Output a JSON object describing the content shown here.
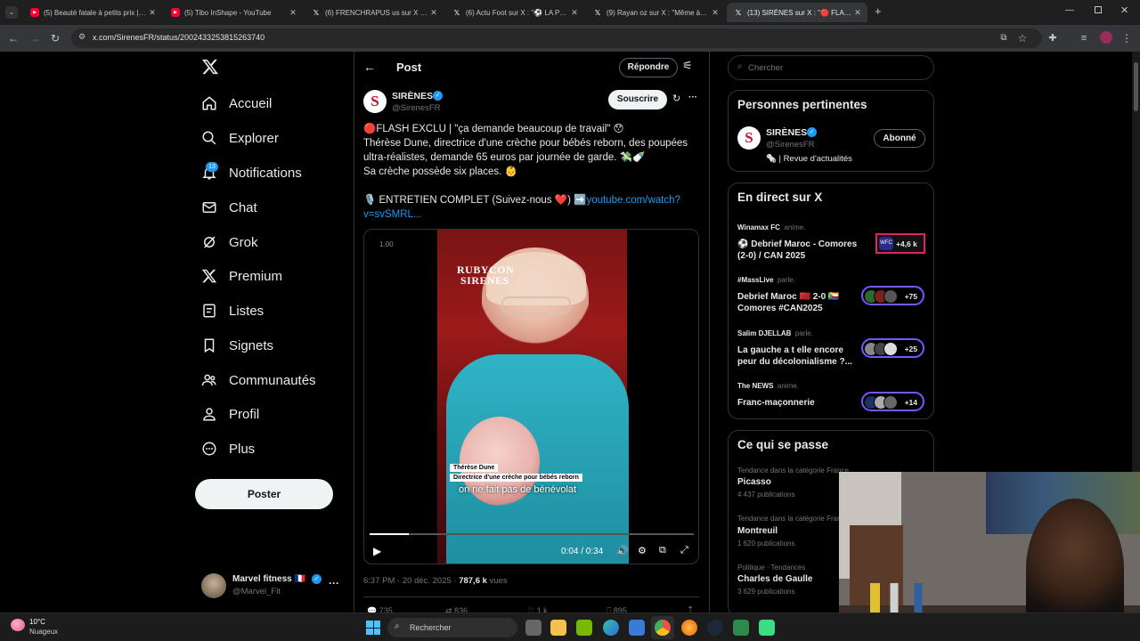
{
  "browser": {
    "tabs": [
      {
        "title": "(5) Beauté fatale à petits prix | ...",
        "icon": "youtube-icon"
      },
      {
        "title": "(5) Tibo InShape - YouTube",
        "icon": "youtube-icon"
      },
      {
        "title": "(6) FRENCHRAPUS us sur X : \"...",
        "icon": "x-icon"
      },
      {
        "title": "(6) Actu Foot sur X : \"⚽ LA PL...",
        "icon": "x-icon"
      },
      {
        "title": "(9) Rayan oz sur X : \"Même à la...",
        "icon": "x-icon"
      },
      {
        "title": "(13) SIRÈNES sur X : \"🔴 FLASH...",
        "icon": "x-icon",
        "active": true
      }
    ],
    "url": "x.com/SirenesFR/status/2002433253815263740"
  },
  "nav": {
    "items": [
      {
        "label": "Accueil",
        "icon": "home-icon"
      },
      {
        "label": "Explorer",
        "icon": "search-icon"
      },
      {
        "label": "Notifications",
        "icon": "bell-icon",
        "badge": "13"
      },
      {
        "label": "Chat",
        "icon": "mail-icon"
      },
      {
        "label": "Grok",
        "icon": "grok-icon"
      },
      {
        "label": "Premium",
        "icon": "x-logo-icon"
      },
      {
        "label": "Listes",
        "icon": "list-icon"
      },
      {
        "label": "Signets",
        "icon": "bookmark-icon"
      },
      {
        "label": "Communautés",
        "icon": "communities-icon"
      },
      {
        "label": "Profil",
        "icon": "person-icon"
      },
      {
        "label": "Plus",
        "icon": "more-circle-icon"
      }
    ],
    "post_button": "Poster",
    "account": {
      "name": "Marvel fitness 🇫🇷",
      "handle": "@Marvel_Flt"
    }
  },
  "post": {
    "header_title": "Post",
    "reply_button": "Répondre",
    "author_name": "SIRÈNES",
    "author_handle": "@SirenesFR",
    "subscribe_button": "Souscrire",
    "text_lines": [
      "🔴FLASH EXCLU | \"ça demande beaucoup de travail\" 😯",
      "Thérèse Dune, directrice d'une crèche pour bébés reborn, des poupées",
      "ultra-réalistes, demande 65 euros par journée de garde. 💸🍼",
      "Sa crèche possède six places. 👶",
      "🎙️ ENTRETIEN COMPLET (Suivez-nous ❤️) ➡️"
    ],
    "link_text_1": "youtube.com/watch?",
    "link_text_2": "v=svSMRL...",
    "video": {
      "speed_label": "1.00",
      "watermark_top": "RUBYCON",
      "watermark_bottom": "SIRENES",
      "caption_name": "Thérèse Dune",
      "caption_role": "Directrice d'une crèche pour bébés reborn",
      "subtitle": "on ne fait pas de bénévolat",
      "time": "0:04 / 0:34",
      "progress_fraction": 0.12
    },
    "meta_time": "6:37 PM · 20 déc. 2025 · ",
    "meta_views": "787,6 k",
    "meta_views_label": " vues",
    "actions": [
      "735",
      "836",
      "1 k",
      "895"
    ]
  },
  "search": {
    "placeholder": "Chercher"
  },
  "relevant": {
    "title": "Personnes pertinentes",
    "name": "SIRÈNES",
    "handle": "@SirenesFR",
    "bio": "🗞️ | Revue d'actualités",
    "follow_button": "Abonné"
  },
  "live": {
    "title": "En direct sur X",
    "items": [
      {
        "host": "Winamax FC",
        "activity": "anime.",
        "title_1": "⚽ Debrief Maroc - Comores",
        "title_2": "(2-0) / CAN 2025",
        "count": "+4,6 k"
      },
      {
        "host": "#MassLive",
        "activity": "parle.",
        "title_1": "Debrief Maroc 🇲🇦 2-0 🇰🇲",
        "title_2": "Comores #CAN2025",
        "count": "+75"
      },
      {
        "host": "Salim DJELLAB",
        "activity": "parle.",
        "title_1": "La gauche a t elle encore",
        "title_2": "peur du décolonialisme ?...",
        "count": "+25"
      },
      {
        "host": "The NEWS",
        "activity": "anime.",
        "title_1": "Franc-maçonnerie",
        "title_2": "",
        "count": "+14"
      }
    ]
  },
  "trends": {
    "title": "Ce qui se passe",
    "items": [
      {
        "category": "Tendance dans la catégorie France",
        "name": "Picasso",
        "count": "4 437 publications"
      },
      {
        "category": "Tendance dans la catégorie France",
        "name": "Montreuil",
        "count": "1 620 publications"
      },
      {
        "category": "Politique · Tendances",
        "name": "Charles de Gaulle",
        "count": "3 629 publications"
      }
    ]
  },
  "taskbar": {
    "weather_temp": "10°C",
    "weather_desc": "Nuageux",
    "search_label": "Rechercher"
  },
  "colors": {
    "accent": "#1d9bf0",
    "live_border": "#7856ff",
    "background": "#000000",
    "red_dot": "#e0245e"
  }
}
